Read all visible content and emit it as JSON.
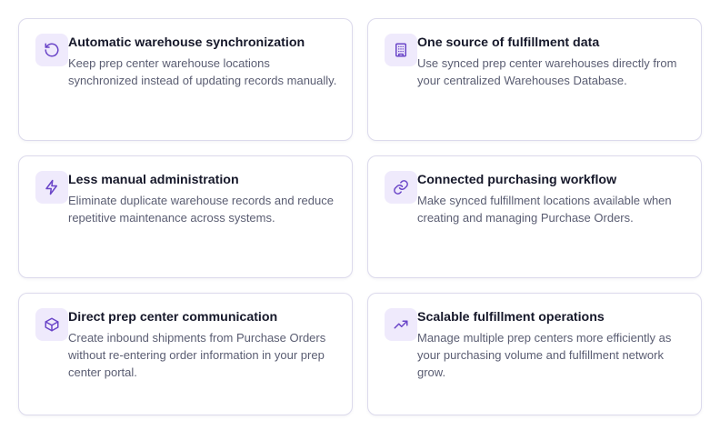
{
  "features": [
    {
      "icon": "rotate-ccw-icon",
      "title": "Automatic warehouse synchronization",
      "description": "Keep prep center warehouse locations synchronized instead of updating records manually."
    },
    {
      "icon": "building-icon",
      "title": "One source of fulfillment data",
      "description": "Use synced prep center warehouses directly from your centralized Warehouses Database."
    },
    {
      "icon": "lightning-bolt-icon",
      "title": "Less manual administration",
      "description": "Eliminate duplicate warehouse records and reduce repetitive maintenance across systems."
    },
    {
      "icon": "link-icon",
      "title": "Connected purchasing workflow",
      "description": "Make synced fulfillment locations available when creating and managing Purchase Orders."
    },
    {
      "icon": "box-icon",
      "title": "Direct prep center communication",
      "description": "Create inbound shipments from Purchase Orders without re-entering order information in your prep center portal."
    },
    {
      "icon": "trending-up-icon",
      "title": "Scalable fulfillment operations",
      "description": "Manage multiple prep centers more efficiently as your purchasing volume and fulfillment network grow."
    }
  ],
  "colors": {
    "accent": "#6a45c8",
    "icon_bg": "#efeafc",
    "card_border": "#dcdaec",
    "title": "#16182a",
    "description": "#5a5d72"
  }
}
